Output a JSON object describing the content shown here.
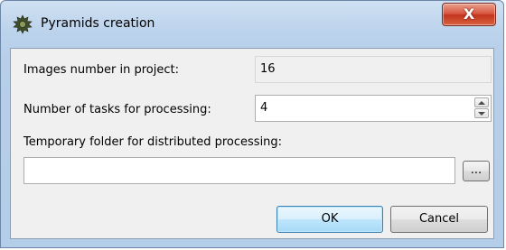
{
  "window": {
    "title": "Pyramids creation",
    "close_label": "X",
    "app_icon": "pyramid-gear-icon",
    "close_icon": "close-icon"
  },
  "form": {
    "images_label": "Images number in project:",
    "images_value": "16",
    "tasks_label": "Number of tasks for processing:",
    "tasks_value": "4",
    "spinner_icons": [
      "spin-up-icon",
      "spin-down-icon"
    ],
    "folder_label": "Temporary folder for distributed processing:",
    "folder_value": "",
    "browse_label": "..."
  },
  "buttons": {
    "ok_label": "OK",
    "cancel_label": "Cancel"
  },
  "colors": {
    "title_bar": "#bcd3ec",
    "close_button": "#c2331d",
    "default_button_border": "#3c7fb1"
  }
}
